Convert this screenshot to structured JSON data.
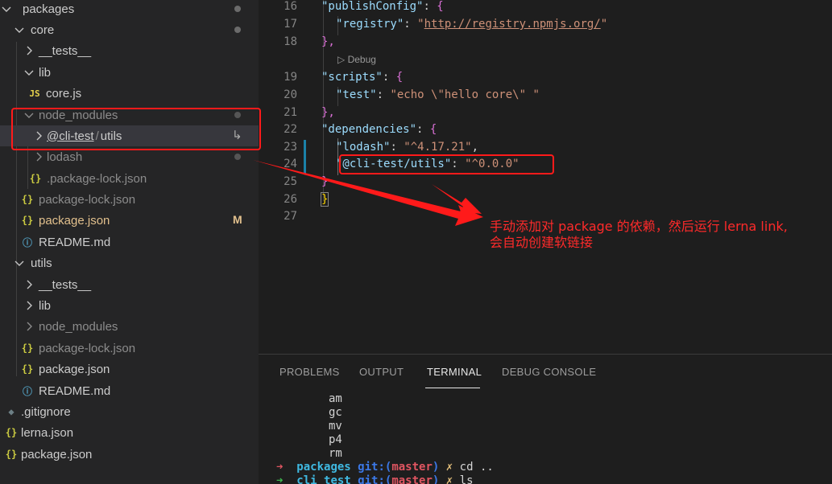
{
  "explorer": {
    "rows": [
      {
        "label": "packages",
        "badge": "dot"
      },
      {
        "label": "core",
        "badge": "dot"
      },
      {
        "label": "__tests__"
      },
      {
        "label": "lib"
      },
      {
        "label": "core.js",
        "icon_text": "JS"
      },
      {
        "label": "node_modules",
        "badge": "dot"
      },
      {
        "label_scope": "@cli-test",
        "label_sep": "/",
        "label_name": "utils",
        "badge": "symlink-arrow"
      },
      {
        "label": "lodash",
        "badge": "dot"
      },
      {
        "label": ".package-lock.json",
        "icon_text": "{}"
      },
      {
        "label": "package-lock.json",
        "icon_text": "{}"
      },
      {
        "label": "package.json",
        "icon_text": "{}",
        "badge_text": "M"
      },
      {
        "label": "README.md",
        "icon_text": "ⓘ"
      },
      {
        "label": "utils"
      },
      {
        "label": "__tests__"
      },
      {
        "label": "lib"
      },
      {
        "label": "node_modules"
      },
      {
        "label": "package-lock.json",
        "icon_text": "{}"
      },
      {
        "label": "package.json",
        "icon_text": "{}"
      },
      {
        "label": "README.md",
        "icon_text": "ⓘ"
      },
      {
        "label": ".gitignore",
        "icon_text": "◆"
      },
      {
        "label": "lerna.json",
        "icon_text": "{}"
      },
      {
        "label": "package.json",
        "icon_text": "{}"
      }
    ]
  },
  "editor": {
    "line_numbers": [
      "16",
      "17",
      "18",
      "19",
      "20",
      "21",
      "22",
      "23",
      "24",
      "25",
      "26",
      "27"
    ],
    "codelens": "▷ Debug",
    "lines": {
      "l16_key": "\"publishConfig\"",
      "l16_colon": ": ",
      "l16_brace": "{",
      "l17_key": "\"registry\"",
      "l17_colon": ": ",
      "l17_q1": "\"",
      "l17_url": "http://registry.npmjs.org/",
      "l17_q2": "\"",
      "l18": "},",
      "l19_key": "\"scripts\"",
      "l19_colon": ": ",
      "l19_brace": "{",
      "l20_key": "\"test\"",
      "l20_colon": ": ",
      "l20_val": "\"echo \\\"hello core\\\" \"",
      "l21": "},",
      "l22_key": "\"dependencies\"",
      "l22_colon": ": ",
      "l22_brace": "{",
      "l23_key": "\"lodash\"",
      "l23_colon": ": ",
      "l23_val": "\"^4.17.21\"",
      "l23_comma": ",",
      "l24_key": "\"@cli-test/utils\"",
      "l24_colon": ": ",
      "l24_val": "\"^0.0.0\"",
      "l25": "}",
      "l26": "}"
    }
  },
  "panel": {
    "tabs": [
      "PROBLEMS",
      "OUTPUT",
      "TERMINAL",
      "DEBUG CONSOLE"
    ],
    "active_tab": "TERMINAL",
    "terminal": {
      "listing": [
        "am",
        "gc",
        "mv",
        "p4",
        "rm"
      ],
      "prompt1": {
        "arrow": "➜",
        "dir": "packages",
        "git": "git:(",
        "branch": "master",
        "git_close": ")",
        "x": "✗",
        "cmd": "cd .."
      },
      "prompt2": {
        "arrow": "➜",
        "dir": "cli_test",
        "git": "git:(",
        "branch": "master",
        "git_close": ")",
        "x": "✗",
        "cmd": "ls"
      }
    }
  },
  "annotation": {
    "line1": "手动添加对 package 的依赖，然后运行 lerna link,",
    "line2": "会自动创建软链接",
    "color": "#ff1a1a"
  }
}
